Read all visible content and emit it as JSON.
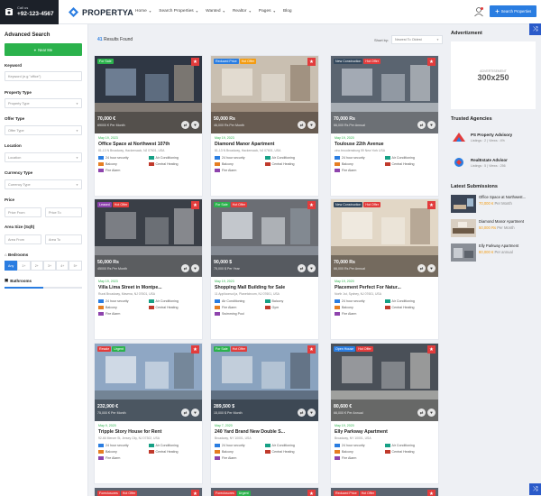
{
  "header": {
    "call_label": "Call us",
    "phone": "+92-123-4567",
    "logo": "PROPERTYA",
    "nav": [
      "Home",
      "Search Properties",
      "Wanted",
      "Realtor",
      "Pages",
      "Blog"
    ],
    "search_button": "Search Properties"
  },
  "sidebar": {
    "title": "Advanced Search",
    "near_me": "Near Me",
    "keyword_label": "Keyword",
    "keyword_placeholder": "Keyword (e.g \"office\")",
    "property_type_label": "Property Type",
    "property_type_value": "Property Type",
    "offer_type_label": "Offer Type",
    "offer_type_value": "Offer Type",
    "location_label": "Location",
    "location_value": "Location",
    "currency_label": "Currency Type",
    "currency_value": "Currency Type",
    "price_label": "Price",
    "price_from": "Price From",
    "price_to": "Price To",
    "area_label": "Area Size (Sqft)",
    "area_from": "Area From",
    "area_to": "Area To",
    "bedrooms_label": "Bedrooms",
    "bedrooms": [
      "Any",
      "1+",
      "2+",
      "3+",
      "4+",
      "5+"
    ],
    "bathrooms_label": "Bathrooms"
  },
  "main": {
    "results_count": "41",
    "results_text": "Results Found",
    "sort_label": "Short by:",
    "sort_value": "Newest To Oldest"
  },
  "cards": [
    {
      "badges": [
        {
          "t": "For Sale",
          "c": "#2bb24c"
        }
      ],
      "price": "70,000 €",
      "sub": "69000 € Per Month",
      "date": "May 19, 2023",
      "title": "Office Space at Northwest 107th",
      "addr": "81-13 N Broadway, Hackensack, NJ 07601, USA",
      "feats": [
        "24 hour security",
        "Air Conditioning",
        "Balcony",
        "Central Heating",
        "Fire Alarm"
      ]
    },
    {
      "badges": [
        {
          "t": "Reduced Price",
          "c": "#2a7de1"
        },
        {
          "t": "Hot Offer",
          "c": "#f39c12"
        }
      ],
      "price": "50,000 Rs",
      "sub": "46,000 Rs Per Month",
      "date": "May 19, 2023",
      "title": "Diamond Manor Apartment",
      "addr": "81-13 N Broadway, Hackensack, NJ 07601, USA",
      "feats": [
        "24 hour security",
        "Air Conditioning",
        "Balcony",
        "Central Heating",
        "Fire Alarm"
      ]
    },
    {
      "badges": [
        {
          "t": "New Construction",
          "c": "#34495e"
        },
        {
          "t": "Hot Offer",
          "c": "#e23c3c"
        }
      ],
      "price": "70,000 Rs",
      "sub": "66,000 Rs Per Annual",
      "date": "May 19, 2020",
      "title": "Toulouse 22th Avenue",
      "addr": "zino broodensburg 59 New York USA",
      "feats": [
        "24 hour security",
        "Air Conditioning",
        "Balcony",
        "Central Heating",
        "Fire Alarm"
      ]
    },
    {
      "badges": [
        {
          "t": "Leased",
          "c": "#8e44ad"
        },
        {
          "t": "Hot Offer",
          "c": "#e23c3c"
        }
      ],
      "price": "50,000 Rs",
      "sub": "45000 Rs Per Month",
      "date": "May 19, 2023",
      "title": "Villa Lima Street in Montpe...",
      "addr": "Rural Broadway, Mavena, NJ 07601, USA",
      "feats": [
        "24 hour security",
        "Air Conditioning",
        "Balcony",
        "Central Heating",
        "Fire Alarm"
      ]
    },
    {
      "badges": [
        {
          "t": "For Sale",
          "c": "#2bb24c"
        },
        {
          "t": "Hot Offer",
          "c": "#e23c3c"
        }
      ],
      "price": "90,000 $",
      "sub": "75,000 $ Per Year",
      "date": "May 19, 2023",
      "title": "Shopping Mall Building for Sale",
      "addr": "11 Appliconsol ja, Planetcircom, NJ 07601, USA",
      "feats": [
        "Air Conditioning",
        "Balcony",
        "Fire Alarm",
        "Gym",
        "Swimming Pool"
      ]
    },
    {
      "badges": [
        {
          "t": "New Construction",
          "c": "#34495e"
        },
        {
          "t": "Hot Offer",
          "c": "#e23c3c"
        }
      ],
      "price": "70,000 Rs",
      "sub": "66,000 Rs Per Annual",
      "date": "May 19, 2020",
      "title": "Placement Perfect For Natur...",
      "addr": "North 1st, Sydney, NJ 07601, USA",
      "feats": [
        "24 hour security",
        "Air Conditioning",
        "Balcony",
        "Central Heating",
        "Fire Alarm"
      ]
    },
    {
      "badges": [
        {
          "t": "Resale",
          "c": "#e23c3c"
        },
        {
          "t": "Urgent",
          "c": "#2bb24c"
        }
      ],
      "price": "232,900 €",
      "sub": "75,000 € Per Month",
      "date": "May 9, 2020",
      "title": "Tripple Story House for Rent",
      "addr": "92-66 Mercer St, Jersey City, NJ 07302, USA",
      "feats": [
        "24 hour security",
        "Air Conditioning",
        "Balcony",
        "Central Heating",
        "Fire Alarm"
      ]
    },
    {
      "badges": [
        {
          "t": "For Sale",
          "c": "#2bb24c"
        },
        {
          "t": "Hot Offer",
          "c": "#e23c3c"
        }
      ],
      "price": "289,500 $",
      "sub": "15,000 $ Per Month",
      "date": "May 7, 2020",
      "title": "240 Yard Brand New Double S...",
      "addr": "Broadway, NY 10001, USA",
      "feats": [
        "24 hour security",
        "Air Conditioning",
        "Balcony",
        "Central Heating",
        "Fire Alarm"
      ]
    },
    {
      "badges": [
        {
          "t": "Open House",
          "c": "#2a7de1"
        },
        {
          "t": "Hot Offer",
          "c": "#e23c3c"
        }
      ],
      "price": "80,600 €",
      "sub": "66,000 € Per Annual",
      "date": "May 19, 2020",
      "title": "Elly Parkway Apartment",
      "addr": "Broadway, NY 10001, USA",
      "feats": [
        "24 hour security",
        "Air Conditioning",
        "Balcony",
        "Central Heating",
        "Fire Alarm"
      ]
    }
  ],
  "bottom_badges": [
    [
      {
        "t": "Foreclosures",
        "c": "#e23c3c"
      },
      {
        "t": "Hot Offer",
        "c": "#e23c3c"
      }
    ],
    [
      {
        "t": "Foreclosures",
        "c": "#e23c3c"
      },
      {
        "t": "Urgent",
        "c": "#2bb24c"
      }
    ],
    [
      {
        "t": "Reduced Price",
        "c": "#e23c3c"
      },
      {
        "t": "Hot Offer",
        "c": "#e23c3c"
      }
    ]
  ],
  "right": {
    "ad_title": "Advertizment",
    "ad_small": "ADVERTISEMENT",
    "ad_size": "300x250",
    "agencies_title": "Trusted Agencies",
    "agencies": [
      {
        "name": "PS Property Advisory",
        "meta": "Listings : 2  |  Views : 4%"
      },
      {
        "name": "RealEstate Advisor",
        "meta": "Listings : 5  |  Views : 256"
      }
    ],
    "latest_title": "Latest Submissions",
    "latest": [
      {
        "title": "Office Space at Northwest...",
        "price": "70,000 €",
        "per": "Per Month"
      },
      {
        "title": "Diamond Manor Apartment",
        "price": "50,000 Rs",
        "per": "Per Month"
      },
      {
        "title": "Elly Parkway Apartment",
        "price": "80,000 €",
        "per": "Per annual"
      }
    ]
  }
}
